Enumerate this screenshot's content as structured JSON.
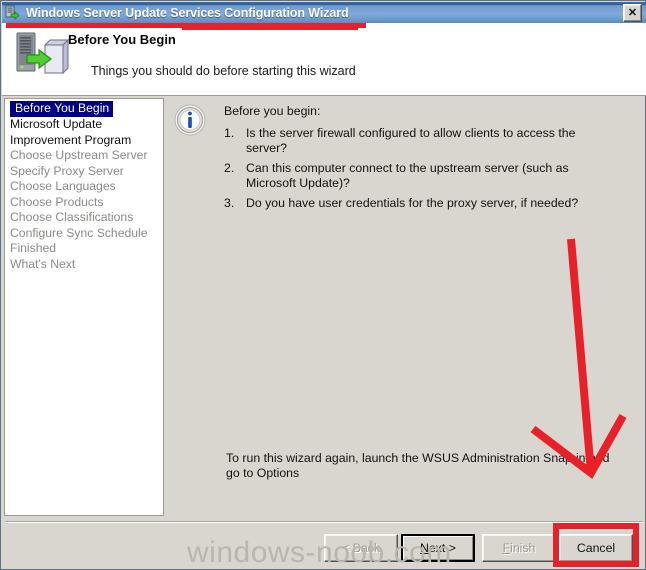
{
  "window": {
    "title": "Windows Server Update Services Configuration Wizard",
    "icon": "wsus-server-icon",
    "close_label": "✕"
  },
  "header": {
    "icon": "wsus-server-arrow-icon",
    "title": "Before You Begin",
    "subtitle": "Things you should do before starting this wizard"
  },
  "sidebar": {
    "items": [
      {
        "label": "Before You Begin",
        "state": "active"
      },
      {
        "label": "Microsoft Update Improvement Program",
        "state": "done"
      },
      {
        "label": "Choose Upstream Server",
        "state": "pending"
      },
      {
        "label": "Specify Proxy Server",
        "state": "pending"
      },
      {
        "label": "Choose Languages",
        "state": "pending"
      },
      {
        "label": "Choose Products",
        "state": "pending"
      },
      {
        "label": "Choose Classifications",
        "state": "pending"
      },
      {
        "label": "Configure Sync Schedule",
        "state": "pending"
      },
      {
        "label": "Finished",
        "state": "pending"
      },
      {
        "label": "What's Next",
        "state": "pending"
      }
    ]
  },
  "content": {
    "info_icon": "info-icon",
    "intro": "Before you begin:",
    "items": [
      {
        "num": "1.",
        "text": "Is the server firewall configured to allow clients to access the server?"
      },
      {
        "num": "2.",
        "text": "Can this computer connect to the upstream server (such as Microsoft Update)?"
      },
      {
        "num": "3.",
        "text": "Do you have user credentials for the proxy server, if needed?"
      }
    ],
    "footnote": "To run this wizard again, launch the WSUS Administration Snap-in and go to Options"
  },
  "buttons": {
    "back": {
      "label": "< Back",
      "disabled": true
    },
    "next": {
      "label": "Next >",
      "default": true,
      "accel": "N"
    },
    "finish": {
      "label": "Finish",
      "disabled": true,
      "accel": "F"
    },
    "cancel": {
      "label": "Cancel",
      "highlighted": true
    }
  },
  "annotations": {
    "underline": "red-underline-on-title",
    "arrow": "red-arrow-pointing-to-cancel",
    "box": "red-box-around-cancel-button",
    "color": "#e8202a"
  },
  "watermark": {
    "text": "windows-noob.com"
  }
}
